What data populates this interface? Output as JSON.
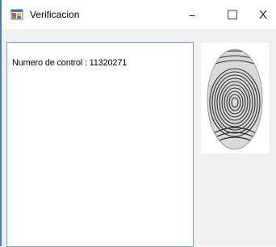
{
  "window": {
    "title": "Verificacion",
    "controls": {
      "minimize": "–",
      "maximize": "☐",
      "close": "X"
    }
  },
  "output": {
    "text": "Numero de control : 11320271"
  },
  "fingerprint": {
    "icon": "fingerprint-image"
  }
}
